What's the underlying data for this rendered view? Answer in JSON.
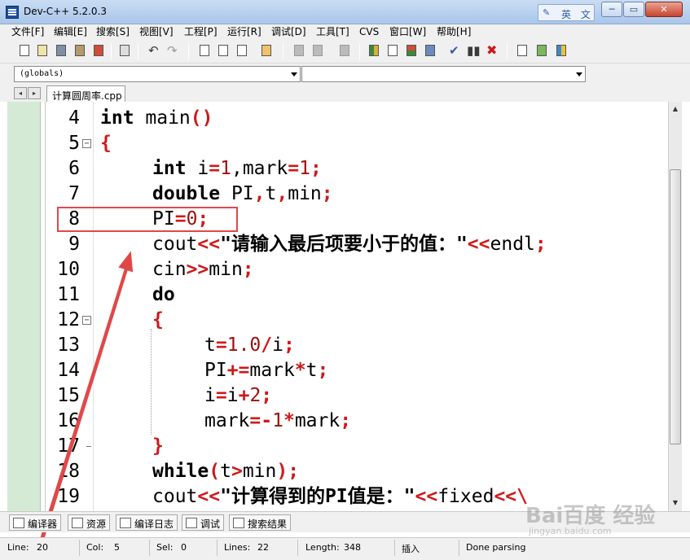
{
  "window": {
    "title": "Dev-C++ 5.2.0.3",
    "ime_label": "英 文",
    "min_label": "─",
    "max_label": "▭",
    "close_label": "✕"
  },
  "menu": [
    "文件[F]",
    "编辑[E]",
    "搜索[S]",
    "视图[V]",
    "工程[P]",
    "运行[R]",
    "调试[D]",
    "工具[T]",
    "CVS",
    "窗口[W]",
    "帮助[H]"
  ],
  "combos": {
    "scope": "(globals)",
    "member": ""
  },
  "tabs": {
    "prev_label": "◂",
    "next_label": "▸",
    "active_file": "计算圆周率.cpp"
  },
  "editor": {
    "lines": [
      {
        "num": "4"
      },
      {
        "num": "5"
      },
      {
        "num": "6"
      },
      {
        "num": "7"
      },
      {
        "num": "8"
      },
      {
        "num": "9"
      },
      {
        "num": "10"
      },
      {
        "num": "11"
      },
      {
        "num": "12"
      },
      {
        "num": "13"
      },
      {
        "num": "14"
      },
      {
        "num": "15"
      },
      {
        "num": "16"
      },
      {
        "num": "17"
      },
      {
        "num": "18"
      },
      {
        "num": "19"
      }
    ],
    "tokens": {
      "l4_kw": "int",
      "l4_rest": " main",
      "l4_op": "()",
      "l5_op": "{",
      "l6_kw": "int",
      "l6_a": " i",
      "l6_op1": "=",
      "l6_n1": "1",
      "l6_b": ",mark",
      "l6_op2": "=",
      "l6_n2": "1",
      "l6_op3": ";",
      "l7_kw": "double",
      "l7_a": " PI",
      "l7_op1": ",",
      "l7_b": "t",
      "l7_op2": ",",
      "l7_c": "min",
      "l7_op3": ";",
      "l8_a": "PI",
      "l8_op1": "=",
      "l8_n1": "0",
      "l8_op2": ";",
      "l9_a": "cout",
      "l9_op1": "<<",
      "l9_str": "\"请输入最后项要小于的值：\"",
      "l9_op2": "<<",
      "l9_b": "endl",
      "l9_op3": ";",
      "l10_a": "cin",
      "l10_op1": ">>",
      "l10_b": "min",
      "l10_op2": ";",
      "l11_kw": "do",
      "l12_op": "{",
      "l13_a": "t",
      "l13_op1": "=",
      "l13_n1": "1.0",
      "l13_op2": "/",
      "l13_b": "i",
      "l13_op3": ";",
      "l14_a": "PI",
      "l14_op1": "+=",
      "l14_b": "mark",
      "l14_op2": "*",
      "l14_c": "t",
      "l14_op3": ";",
      "l15_a": "i",
      "l15_op1": "=",
      "l15_b": "i",
      "l15_op2": "+",
      "l15_n1": "2",
      "l15_op3": ";",
      "l16_a": "mark",
      "l16_op1": "=-",
      "l16_n1": "1",
      "l16_op2": "*",
      "l16_b": "mark",
      "l16_op3": ";",
      "l17_op": "}",
      "l18_kw": "while",
      "l18_op1": "(",
      "l18_a": "t",
      "l18_op2": ">",
      "l18_b": "min",
      "l18_op3": ");",
      "l19_a": "cout",
      "l19_op1": "<<",
      "l19_str": "\"计算得到的PI值是：\"",
      "l19_op2": "<<",
      "l19_b": "fixed",
      "l19_op3": "<<\\"
    },
    "fold_marker": "−"
  },
  "scrollbar": {
    "up": "▲",
    "down": "▼"
  },
  "bottom_tabs": [
    "编译器",
    "资源",
    "编译日志",
    "调试",
    "搜索结果"
  ],
  "status": {
    "line_label": "Line:",
    "line_value": "20",
    "col_label": "Col:",
    "col_value": "5",
    "sel_label": "Sel:",
    "sel_value": "0",
    "lines_label": "Lines:",
    "lines_value": "22",
    "length_label": "Length:",
    "length_value": "348",
    "mode": "插入",
    "message": "Done parsing"
  },
  "watermark": {
    "logo": "Bai百度 经验",
    "url": "jingyan.baidu.com"
  },
  "colors": {
    "annotation": "#e04848",
    "operator": "#d01818",
    "left_panel": "#d4ead4"
  }
}
